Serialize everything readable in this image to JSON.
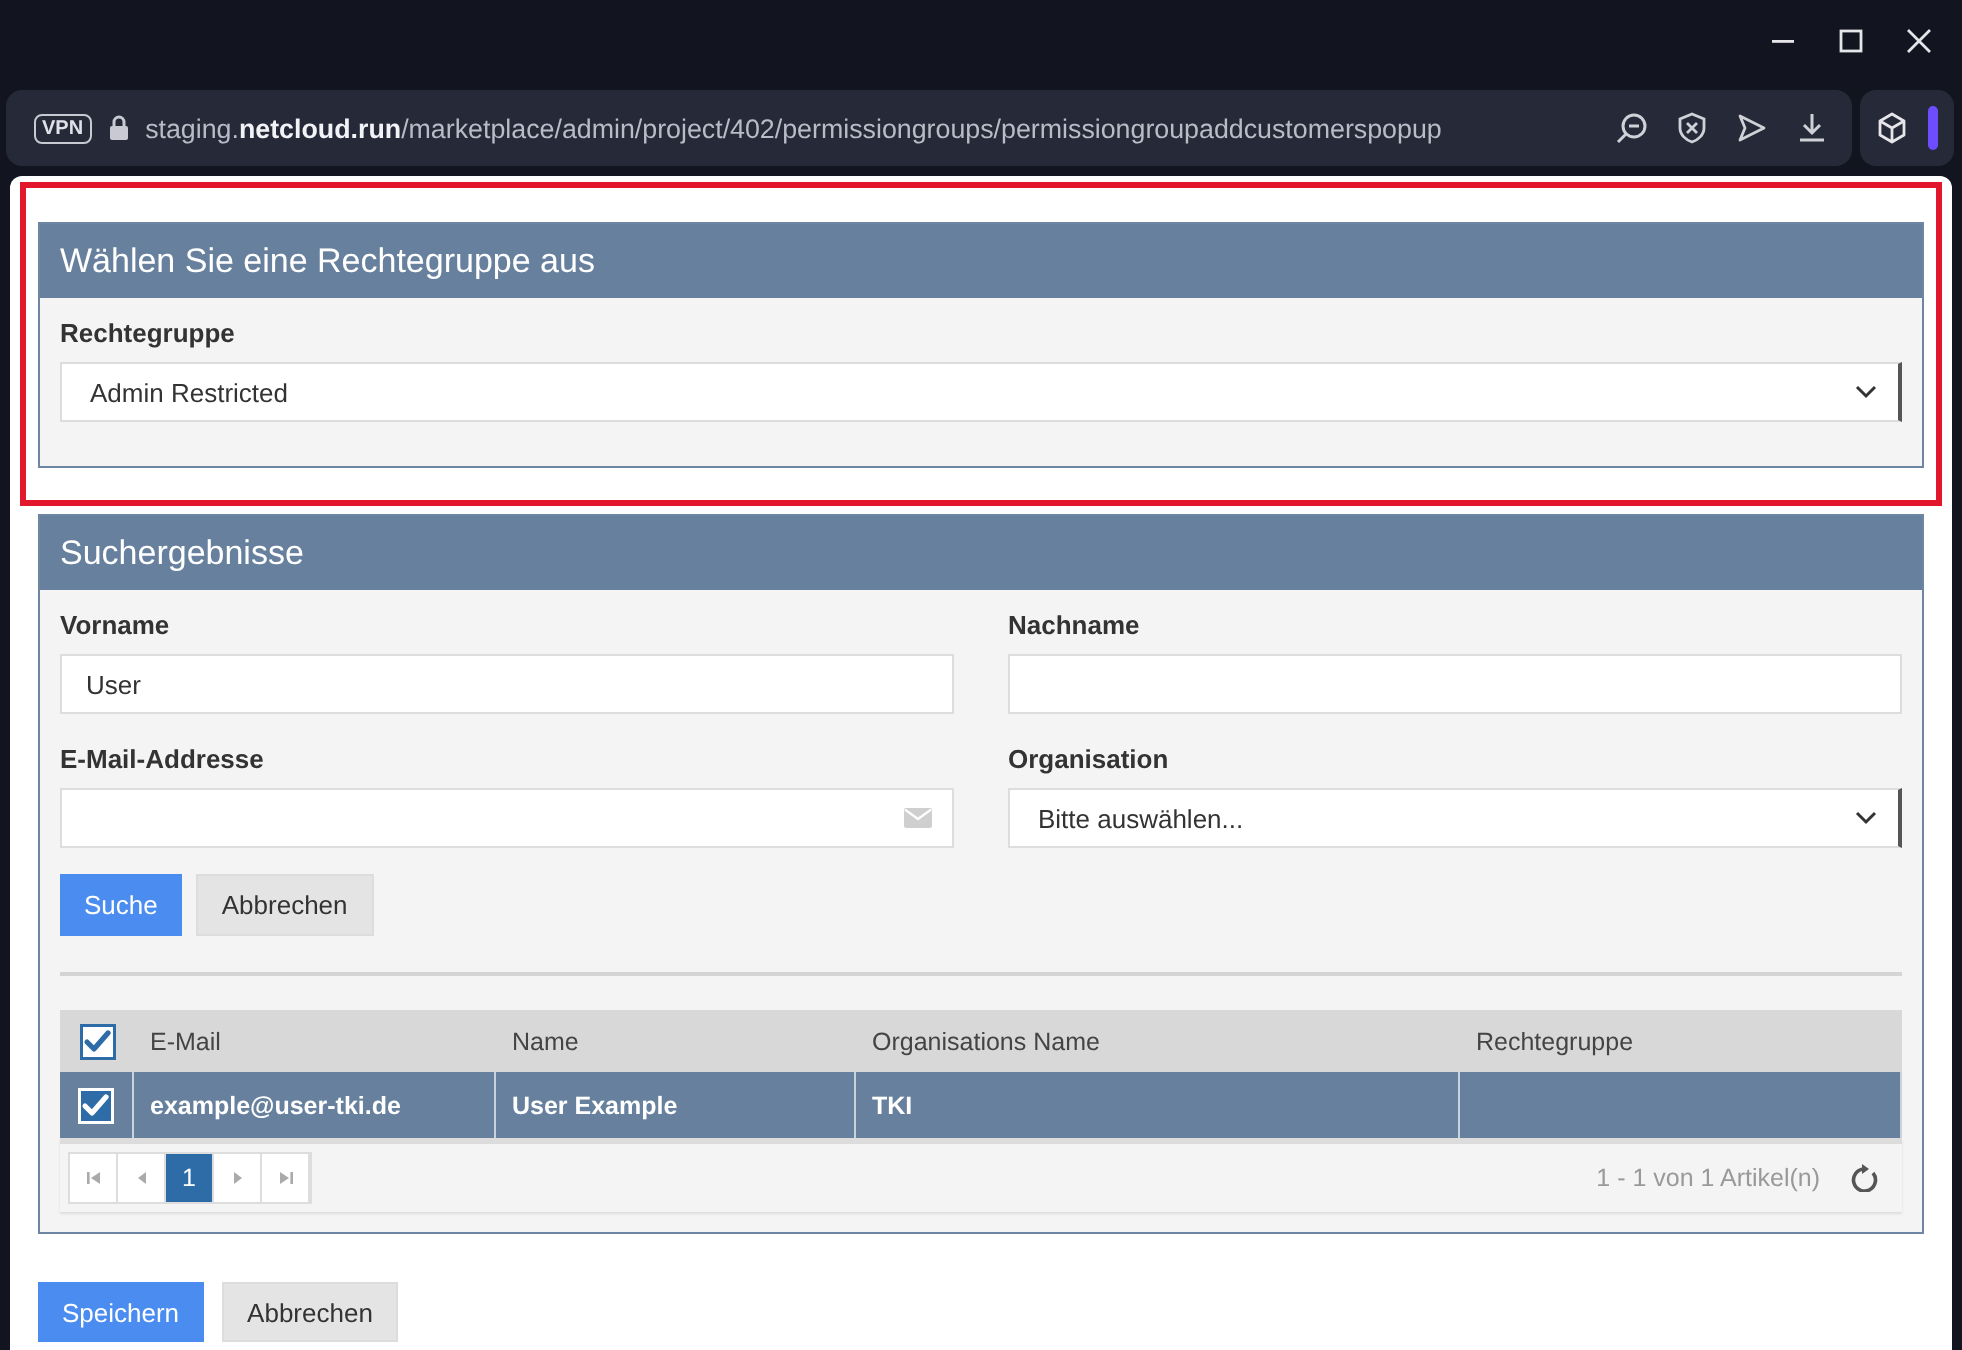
{
  "browser": {
    "vpn_badge": "VPN",
    "url": "staging.**netcloud.run**/marketplace/admin/project/402/permissiongroups/permissiongroupaddcustomerspopup"
  },
  "permission_panel": {
    "highlighted": true,
    "title": "Wählen Sie eine Rechtegruppe aus",
    "field": {
      "kind": "select",
      "label": "Rechtegruppe",
      "value": "Admin Restricted"
    }
  },
  "search_panel": {
    "title": "Suchergebnisse",
    "fields": [
      {
        "kind": "text",
        "label": "Vorname",
        "value": "User"
      },
      {
        "kind": "text",
        "label": "Nachname"
      },
      {
        "kind": "email",
        "label": "E-Mail-Addresse"
      },
      {
        "kind": "select",
        "label": "Organisation",
        "value": "Bitte auswählen..."
      }
    ],
    "buttons": [
      {
        "kind": "primary",
        "label": "Suche"
      },
      {
        "kind": "secondary",
        "label": "Abbrechen"
      }
    ],
    "table": {
      "select_all_checked": true,
      "columns": [
        "E-Mail",
        "Name",
        "Organisations Name",
        "Rechtegruppe"
      ],
      "rows": [
        {
          "checked": true,
          "selected": true,
          "cells": [
            "example@user-tki.de",
            "User Example",
            "TKI"
          ]
        }
      ],
      "pager": {
        "pages": [
          {
            "label": "1",
            "selected": true
          }
        ],
        "summary": "1 - 1 von 1 Artikel(n)"
      }
    }
  },
  "footer_buttons": [
    {
      "kind": "primary",
      "label": "Speichern"
    },
    {
      "kind": "secondary",
      "label": "Abbrechen"
    }
  ]
}
